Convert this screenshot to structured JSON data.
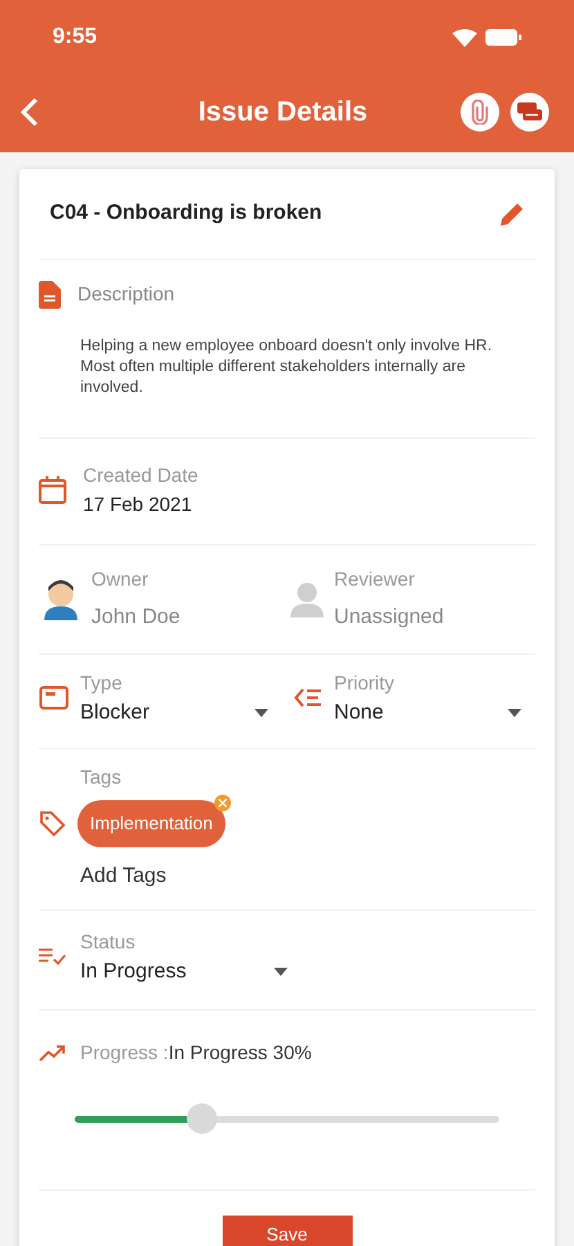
{
  "status_bar": {
    "time": "9:55"
  },
  "header": {
    "title": "Issue Details"
  },
  "issue": {
    "title": "C04 - Onboarding is broken"
  },
  "description": {
    "label": "Description",
    "text": "Helping a new employee onboard doesn't only involve HR. Most often multiple different stakeholders internally are involved."
  },
  "created": {
    "label": "Created Date",
    "value": "17 Feb 2021"
  },
  "people": [
    {
      "label": "Owner",
      "value": "John Doe",
      "kind": "avatar"
    },
    {
      "label": "Reviewer",
      "value": "Unassigned",
      "kind": "placeholder"
    }
  ],
  "selects": [
    {
      "label": "Type",
      "value": "Blocker",
      "kind": "type"
    },
    {
      "label": "Priority",
      "value": "None",
      "kind": "priority"
    }
  ],
  "tags": {
    "label": "Tags",
    "items": [
      "Implementation"
    ],
    "add": "Add Tags"
  },
  "status": {
    "label": "Status",
    "value": "In Progress"
  },
  "progress": {
    "label": "Progress :",
    "value": "In Progress 30%",
    "level": 0.3
  },
  "save": "Save"
}
